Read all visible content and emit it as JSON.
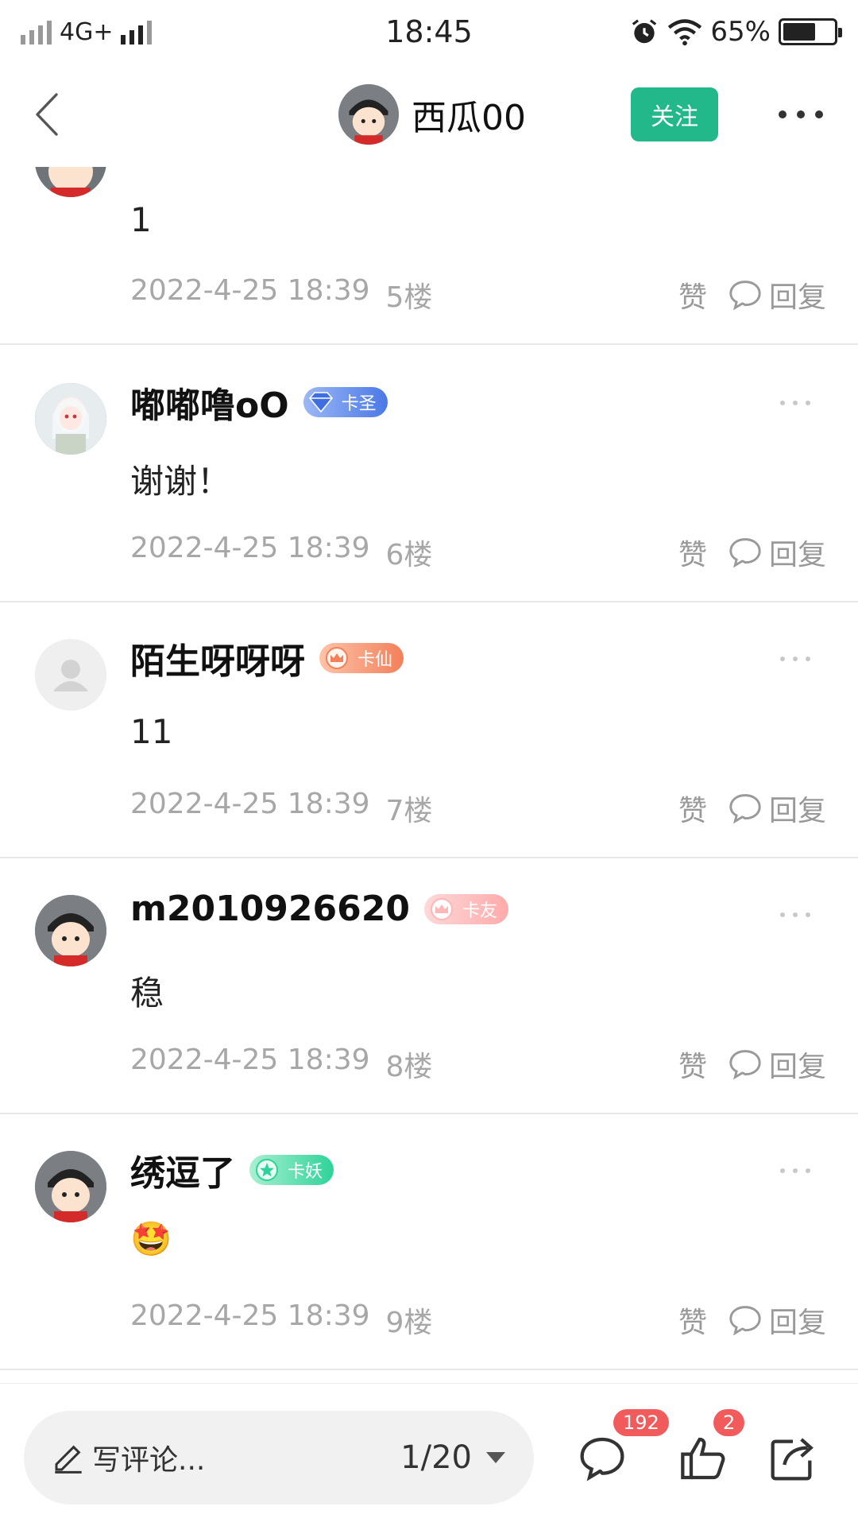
{
  "status_bar": {
    "network": "4G+",
    "time": "18:45",
    "battery_percent": "65%"
  },
  "header": {
    "title": "西瓜00",
    "follow_label": "关注"
  },
  "comments": [
    {
      "username": "",
      "badge": "",
      "content": "1",
      "timestamp": "2022-4-25 18:39",
      "floor": "5楼",
      "like_label": "赞",
      "reply_label": "回复"
    },
    {
      "username": "嘟嘟噜oO",
      "badge": "卡圣",
      "content": "谢谢！",
      "timestamp": "2022-4-25 18:39",
      "floor": "6楼",
      "like_label": "赞",
      "reply_label": "回复"
    },
    {
      "username": "陌生呀呀呀",
      "badge": "卡仙",
      "content": "11",
      "timestamp": "2022-4-25 18:39",
      "floor": "7楼",
      "like_label": "赞",
      "reply_label": "回复"
    },
    {
      "username": "m2010926620",
      "badge": "卡友",
      "content": "稳",
      "timestamp": "2022-4-25 18:39",
      "floor": "8楼",
      "like_label": "赞",
      "reply_label": "回复"
    },
    {
      "username": "绣逗了",
      "badge": "卡妖",
      "content": "🤩",
      "timestamp": "2022-4-25 18:39",
      "floor": "9楼",
      "like_label": "赞",
      "reply_label": "回复"
    }
  ],
  "bottom_bar": {
    "placeholder": "写评论...",
    "page_indicator": "1/20",
    "comment_count": "192",
    "like_count": "2"
  },
  "colors": {
    "accent": "#22b889",
    "badge_red": "#f15b5b",
    "muted_text": "#a7a7a7"
  }
}
